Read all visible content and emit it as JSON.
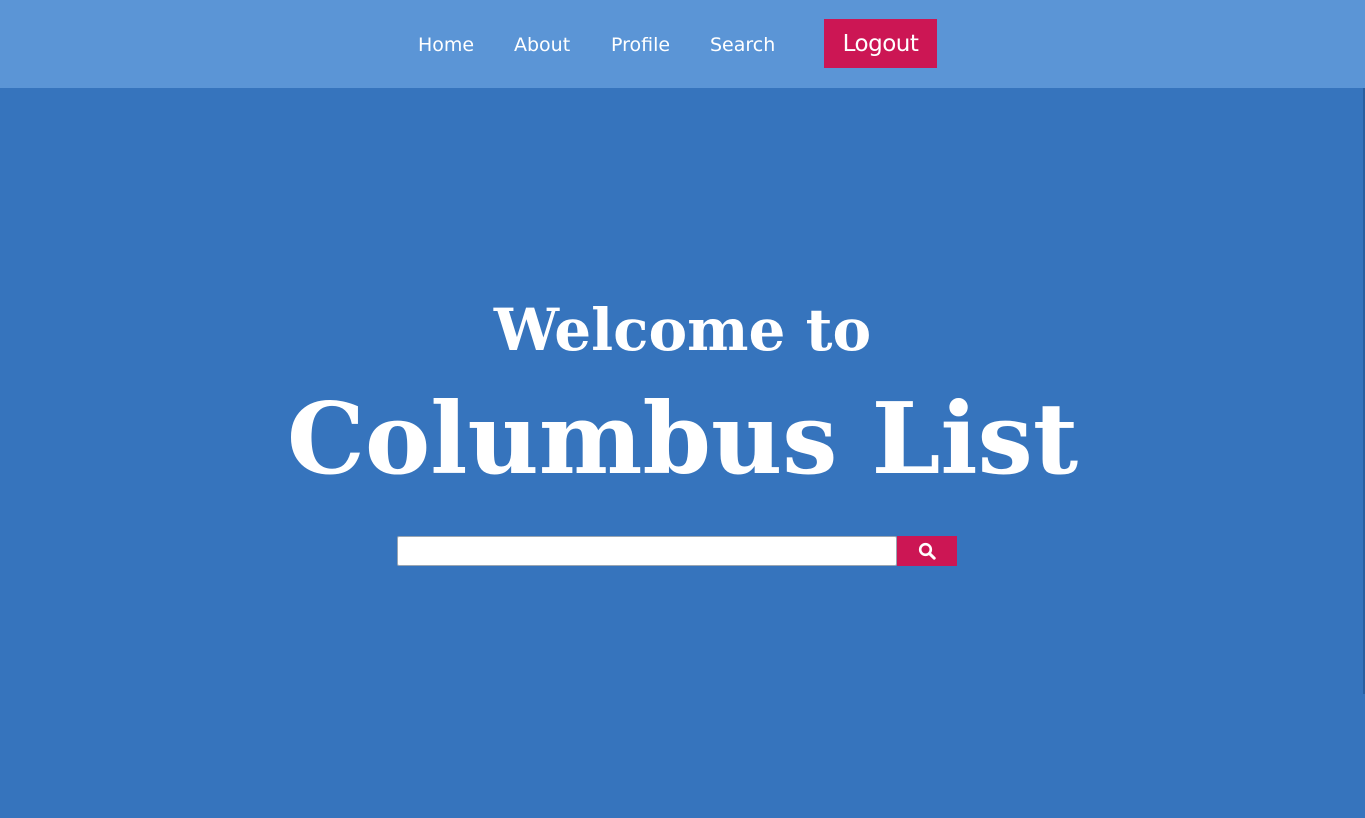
{
  "nav": {
    "items": [
      {
        "label": "Home"
      },
      {
        "label": "About"
      },
      {
        "label": "Profile"
      },
      {
        "label": "Search"
      }
    ],
    "logout_label": "Logout"
  },
  "hero": {
    "welcome": "Welcome to",
    "title": "Columbus List"
  },
  "search": {
    "value": "",
    "placeholder": "",
    "button_icon": "search-icon"
  },
  "colors": {
    "page_background": "#3674bd",
    "nav_background": "#5b95d6",
    "accent": "#cc1654",
    "text": "#ffffff"
  }
}
